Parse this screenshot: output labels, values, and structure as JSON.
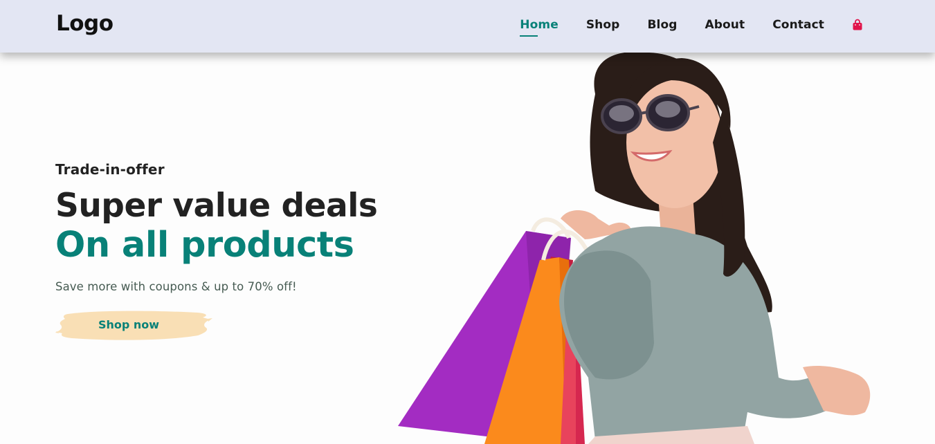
{
  "header": {
    "logo": "Logo",
    "nav": [
      {
        "label": "Home",
        "active": true
      },
      {
        "label": "Shop",
        "active": false
      },
      {
        "label": "Blog",
        "active": false
      },
      {
        "label": "About",
        "active": false
      },
      {
        "label": "Contact",
        "active": false
      }
    ],
    "cart_icon": "shopping-bag-icon"
  },
  "hero": {
    "kicker": "Trade-in-offer",
    "headline": "Super value deals",
    "headline_accent": "On all products",
    "subtitle": "Save more with coupons & up to 70% off!",
    "cta_label": "Shop now",
    "image": "woman-with-shopping-bags"
  },
  "colors": {
    "accent": "#088178",
    "header_bg": "#e3e6f3",
    "cart": "#e0144a",
    "button_brush": "#f9dfb5"
  }
}
